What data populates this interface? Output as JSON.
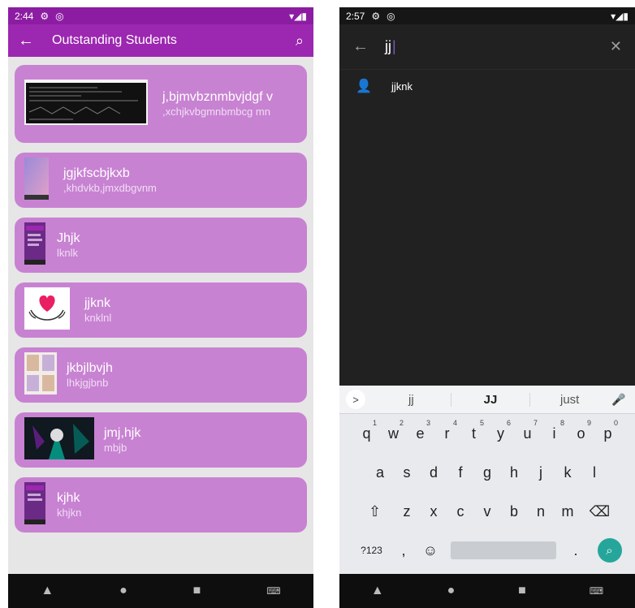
{
  "left": {
    "status": {
      "time": "2:44",
      "gear_icon": "⚙",
      "at_icon": "◎",
      "right_icons": "▾◢▮"
    },
    "appbar": {
      "title": "Outstanding Students",
      "back_icon": "←",
      "search_icon": "⌕"
    },
    "students": [
      {
        "name": "j,bjmvbznmbvjdgf v",
        "subtitle": ",xchjkvbgmnbmbcg mn",
        "thumb": "terminal"
      },
      {
        "name": "jgjkfscbjkxb",
        "subtitle": ",khdvkb,jmxdbgvnm",
        "thumb": "gradient"
      },
      {
        "name": "Jhjk",
        "subtitle": "lknlk",
        "thumb": "phone"
      },
      {
        "name": "jjknk",
        "subtitle": "knklnl",
        "thumb": "heart"
      },
      {
        "name": "jkbjlbvjh",
        "subtitle": "lhkjgjbnb",
        "thumb": "grid"
      },
      {
        "name": "jmj,hjk",
        "subtitle": "mbjb",
        "thumb": "art"
      },
      {
        "name": "kjhk",
        "subtitle": "khjkn",
        "thumb": "phone"
      }
    ],
    "nav": {
      "back": "▲",
      "home": "●",
      "recents": "■",
      "keyboard": "⌨"
    }
  },
  "right": {
    "status": {
      "time": "2:57",
      "gear_icon": "⚙",
      "at_icon": "◎",
      "right_icons": "▾◢▮"
    },
    "search": {
      "query": "jj",
      "back_icon": "←",
      "clear_icon": "✕"
    },
    "result": {
      "name": "jjknk",
      "person_icon": "👤"
    },
    "keyboard": {
      "suggestions": [
        "jj",
        "JJ",
        "just"
      ],
      "expand_icon": ">",
      "mic_icon": "🎤",
      "row1": [
        {
          "k": "q",
          "n": "1"
        },
        {
          "k": "w",
          "n": "2"
        },
        {
          "k": "e",
          "n": "3"
        },
        {
          "k": "r",
          "n": "4"
        },
        {
          "k": "t",
          "n": "5"
        },
        {
          "k": "y",
          "n": "6"
        },
        {
          "k": "u",
          "n": "7"
        },
        {
          "k": "i",
          "n": "8"
        },
        {
          "k": "o",
          "n": "9"
        },
        {
          "k": "p",
          "n": "0"
        }
      ],
      "row2": [
        "a",
        "s",
        "d",
        "f",
        "g",
        "h",
        "j",
        "k",
        "l"
      ],
      "row3": [
        "z",
        "x",
        "c",
        "v",
        "b",
        "n",
        "m"
      ],
      "shift_icon": "⇧",
      "backspace_icon": "⌫",
      "symbols_label": "?123",
      "comma": ",",
      "emoji_icon": "☺",
      "period": ".",
      "search_key_icon": "⌕"
    },
    "nav": {
      "back": "▲",
      "home": "●",
      "recents": "■",
      "keyboard": "⌨"
    }
  }
}
